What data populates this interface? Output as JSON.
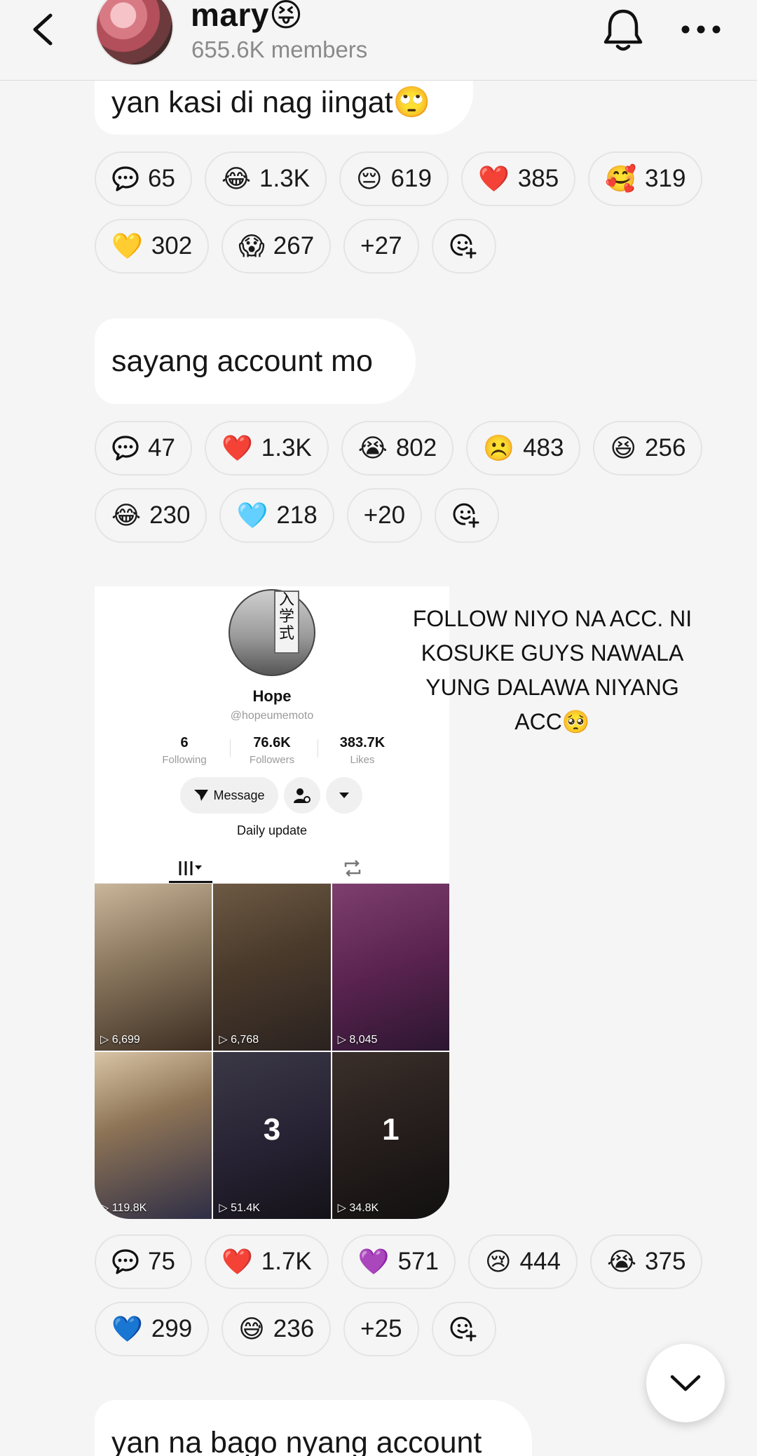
{
  "header": {
    "group_name": "mary😝",
    "member_count": "655.6K members"
  },
  "messages": [
    {
      "text": "yan kasi di nag iingat🙄",
      "reactions": [
        {
          "icon": "comment-icon",
          "count": "65"
        },
        {
          "emoji": "😂",
          "count": "1.3K"
        },
        {
          "emoji": "😔",
          "count": "619"
        },
        {
          "emoji": "❤️",
          "count": "385"
        },
        {
          "emoji": "🥰",
          "count": "319"
        },
        {
          "emoji": "💛",
          "count": "302"
        },
        {
          "emoji": "😱",
          "count": "267"
        },
        {
          "count": "+27"
        }
      ]
    },
    {
      "text": "sayang account mo",
      "reactions": [
        {
          "icon": "comment-icon",
          "count": "47"
        },
        {
          "emoji": "❤️",
          "count": "1.3K"
        },
        {
          "emoji": "😭",
          "count": "802"
        },
        {
          "emoji": "☹️",
          "count": "483"
        },
        {
          "emoji": "😆",
          "count": "256"
        },
        {
          "emoji": "😂",
          "count": "230"
        },
        {
          "emoji": "🩵",
          "count": "218"
        },
        {
          "count": "+20"
        }
      ]
    },
    {
      "caption": "FOLLOW NIYO NA ACC. NI KOSUKE GUYS NAWALA YUNG DALAWA NIYANG ACC🥺",
      "screenshot": {
        "sign_text": "入学式",
        "name": "Hope",
        "handle": "@hopeumemoto",
        "stats": [
          {
            "value": "6",
            "label": "Following"
          },
          {
            "value": "76.6K",
            "label": "Followers"
          },
          {
            "value": "383.7K",
            "label": "Likes"
          }
        ],
        "message_label": "Message",
        "bio": "Daily update",
        "tiles": [
          {
            "views": "6,699",
            "overlay": ""
          },
          {
            "views": "6,768",
            "overlay": ""
          },
          {
            "views": "8,045",
            "overlay": ""
          },
          {
            "views": "119.8K",
            "overlay": ""
          },
          {
            "views": "51.4K",
            "overlay": "3"
          },
          {
            "views": "34.8K",
            "overlay": "1"
          }
        ]
      },
      "reactions": [
        {
          "icon": "comment-icon",
          "count": "75"
        },
        {
          "emoji": "❤️",
          "count": "1.7K"
        },
        {
          "emoji": "💜",
          "count": "571"
        },
        {
          "emoji": "😢",
          "count": "444"
        },
        {
          "emoji": "😭",
          "count": "375"
        },
        {
          "emoji": "💙",
          "count": "299"
        },
        {
          "emoji": "😅",
          "count": "236"
        },
        {
          "count": "+25"
        }
      ]
    },
    {
      "text": "yan na bago nyang account"
    }
  ]
}
